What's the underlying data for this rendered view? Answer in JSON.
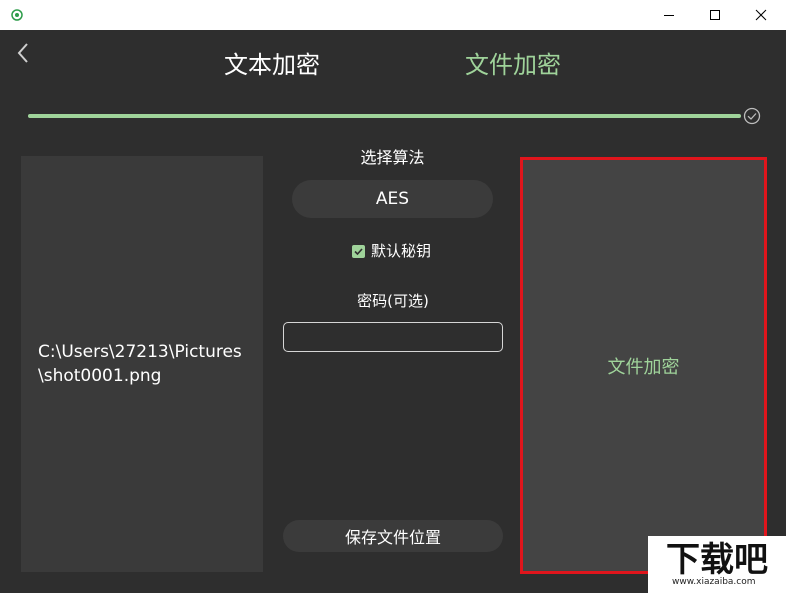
{
  "titlebar": {
    "icons": {
      "app": "app-eye-icon",
      "minimize": "minimize-icon",
      "maximize": "maximize-icon",
      "close": "close-icon"
    }
  },
  "header": {
    "back_icon": "chevron-left-icon",
    "tabs": [
      {
        "label": "文本加密",
        "active": false
      },
      {
        "label": "文件加密",
        "active": true
      }
    ]
  },
  "progress": {
    "value": 1.0,
    "complete_icon": "check-circle-icon"
  },
  "file_panel": {
    "path": "C:\\Users\\27213\\Pictures\\shot0001.png"
  },
  "controls": {
    "algorithm_label": "选择算法",
    "algorithm_value": "AES",
    "default_key_label": "默认秘钥",
    "default_key_checked": true,
    "password_label": "密码(可选)",
    "password_value": "",
    "save_location_label": "保存文件位置"
  },
  "encrypt_button": {
    "label": "文件加密"
  },
  "watermark": {
    "text": "下载吧",
    "site": "www.xiazaiba.com"
  },
  "colors": {
    "accent_green": "#9fd39a",
    "highlight_red": "#e0151c",
    "background": "#2e2e2e",
    "panel": "#3a3a3a"
  }
}
